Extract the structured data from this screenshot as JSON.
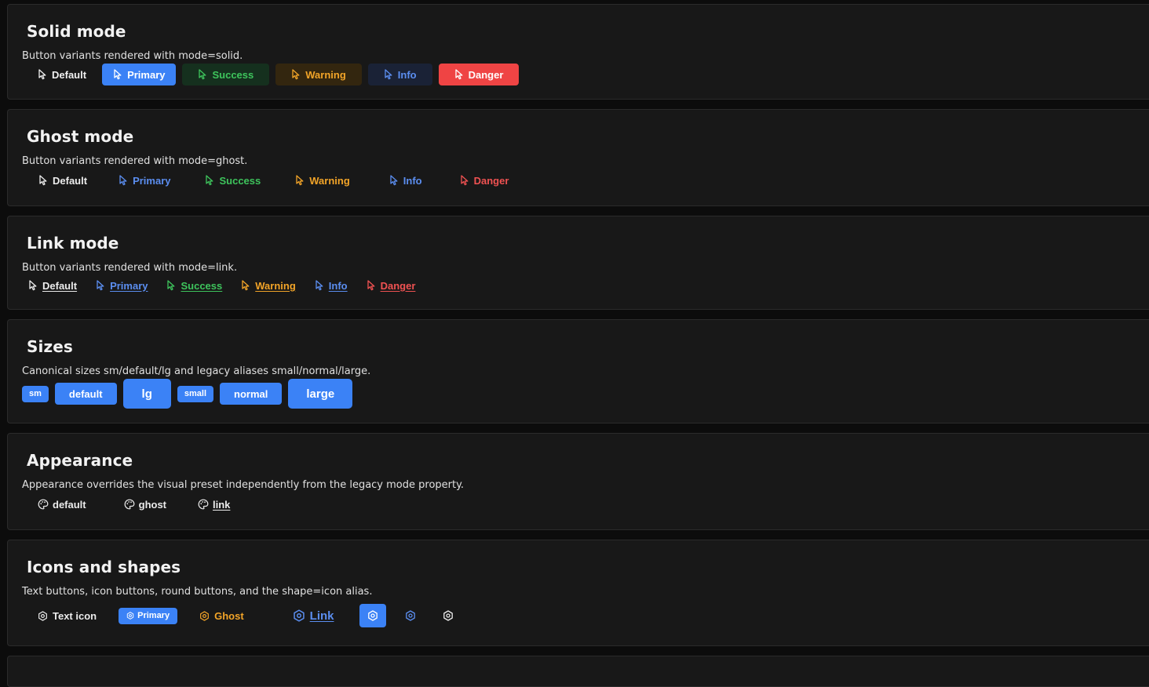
{
  "sections": {
    "solid": {
      "title": "Solid mode",
      "description": "Button variants rendered with mode=solid.",
      "buttons": [
        "Default",
        "Primary",
        "Success",
        "Warning",
        "Info",
        "Danger"
      ]
    },
    "ghost": {
      "title": "Ghost mode",
      "description": "Button variants rendered with mode=ghost.",
      "buttons": [
        "Default",
        "Primary",
        "Success",
        "Warning",
        "Info",
        "Danger"
      ]
    },
    "link": {
      "title": "Link mode",
      "description": "Button variants rendered with mode=link.",
      "buttons": [
        "Default",
        "Primary",
        "Success",
        "Warning",
        "Info",
        "Danger"
      ]
    },
    "sizes": {
      "title": "Sizes",
      "description": "Canonical sizes sm/default/lg and legacy aliases small/normal/large.",
      "buttons": [
        "sm",
        "default",
        "lg",
        "small",
        "normal",
        "large"
      ]
    },
    "appearance": {
      "title": "Appearance",
      "description": "Appearance overrides the visual preset independently from the legacy mode property.",
      "buttons": [
        "default",
        "ghost",
        "link"
      ]
    },
    "icons": {
      "title": "Icons and shapes",
      "description": "Text buttons, icon buttons, round buttons, and the shape=icon alias.",
      "buttons": [
        "Text icon",
        "Primary",
        "Ghost",
        "Link"
      ]
    }
  },
  "icons": {
    "variant_button_icon": "pointer-cursor-icon",
    "appearance_button_icon": "palette-icon",
    "shape_button_icon": "gear-icon"
  },
  "colors": {
    "primary": "#3b82f6",
    "success": "#3ec45c",
    "warning": "#f2a428",
    "info": "#5b8ef0",
    "danger": "#ef4444",
    "card_background": "#181818",
    "page_background": "#0c0c0c"
  }
}
